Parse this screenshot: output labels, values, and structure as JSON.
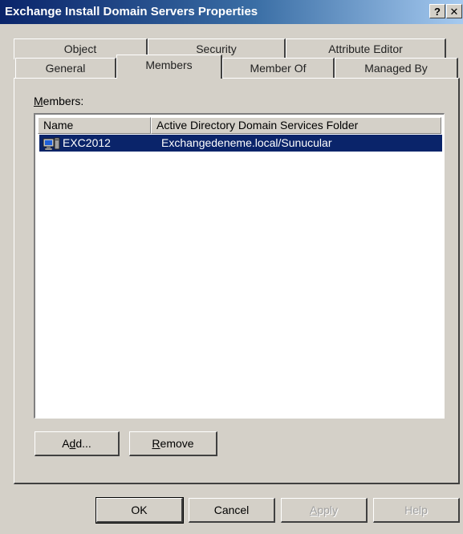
{
  "window": {
    "title": "Exchange Install Domain Servers Properties",
    "help_glyph": "?",
    "close_glyph": "✕"
  },
  "tabs": {
    "row_back": [
      "Object",
      "Security",
      "Attribute Editor"
    ],
    "row_front": [
      "General",
      "Members",
      "Member Of",
      "Managed By"
    ],
    "active": "Members"
  },
  "members": {
    "label_prefix": "M",
    "label_rest": "embers:",
    "columns": [
      "Name",
      "Active Directory Domain Services Folder"
    ],
    "rows": [
      {
        "icon": "computer-icon",
        "name": "EXC2012",
        "folder": "Exchangedeneme.local/Sunucular",
        "selected": true
      }
    ]
  },
  "actions": {
    "add_pre": "A",
    "add_ul": "d",
    "add_post": "d...",
    "remove_ul": "R",
    "remove_rest": "emove"
  },
  "footer": {
    "ok": "OK",
    "cancel": "Cancel",
    "apply_ul": "A",
    "apply_rest": "pply",
    "help": "Help"
  },
  "colors": {
    "selection": "#0a246a",
    "face": "#d4d0c8"
  }
}
